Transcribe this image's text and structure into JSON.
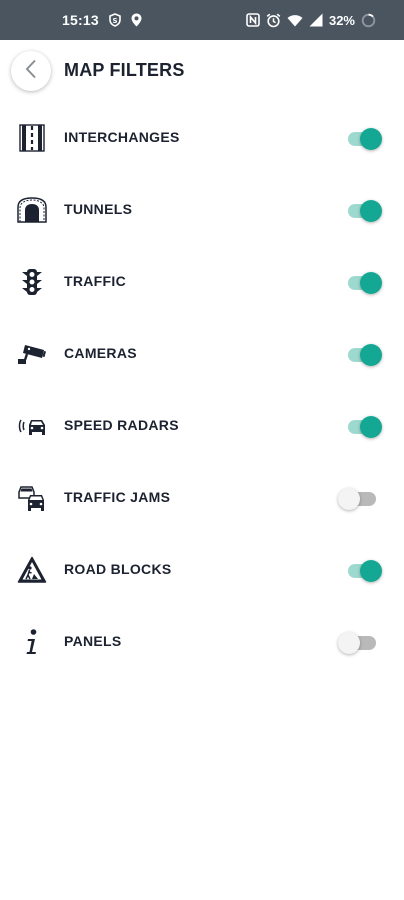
{
  "status_bar": {
    "time": "15:13",
    "battery_percent": "32%",
    "icons": [
      "shield-icon",
      "location-icon",
      "nfc-icon",
      "alarm-icon",
      "wifi-icon",
      "signal-icon",
      "battery-icon"
    ]
  },
  "header": {
    "title": "MAP FILTERS",
    "back_icon": "chevron-left-icon"
  },
  "colors": {
    "status_bar_bg": "#4a5560",
    "toggle_on_thumb": "#14a894",
    "toggle_on_track": "#9ed9cf",
    "toggle_off_thumb": "#f4f4f4",
    "toggle_off_track": "#b9b9b9",
    "text": "#1c2230"
  },
  "filters": [
    {
      "label": "INTERCHANGES",
      "icon": "interchange-icon",
      "enabled": true
    },
    {
      "label": "TUNNELS",
      "icon": "tunnel-icon",
      "enabled": true
    },
    {
      "label": "TRAFFIC",
      "icon": "traffic-light-icon",
      "enabled": true
    },
    {
      "label": "CAMERAS",
      "icon": "camera-icon",
      "enabled": true
    },
    {
      "label": "SPEED RADARS",
      "icon": "speed-radar-icon",
      "enabled": true
    },
    {
      "label": "TRAFFIC JAMS",
      "icon": "traffic-jam-icon",
      "enabled": false
    },
    {
      "label": "ROAD BLOCKS",
      "icon": "road-block-icon",
      "enabled": true
    },
    {
      "label": "PANELS",
      "icon": "info-icon",
      "enabled": false
    }
  ]
}
